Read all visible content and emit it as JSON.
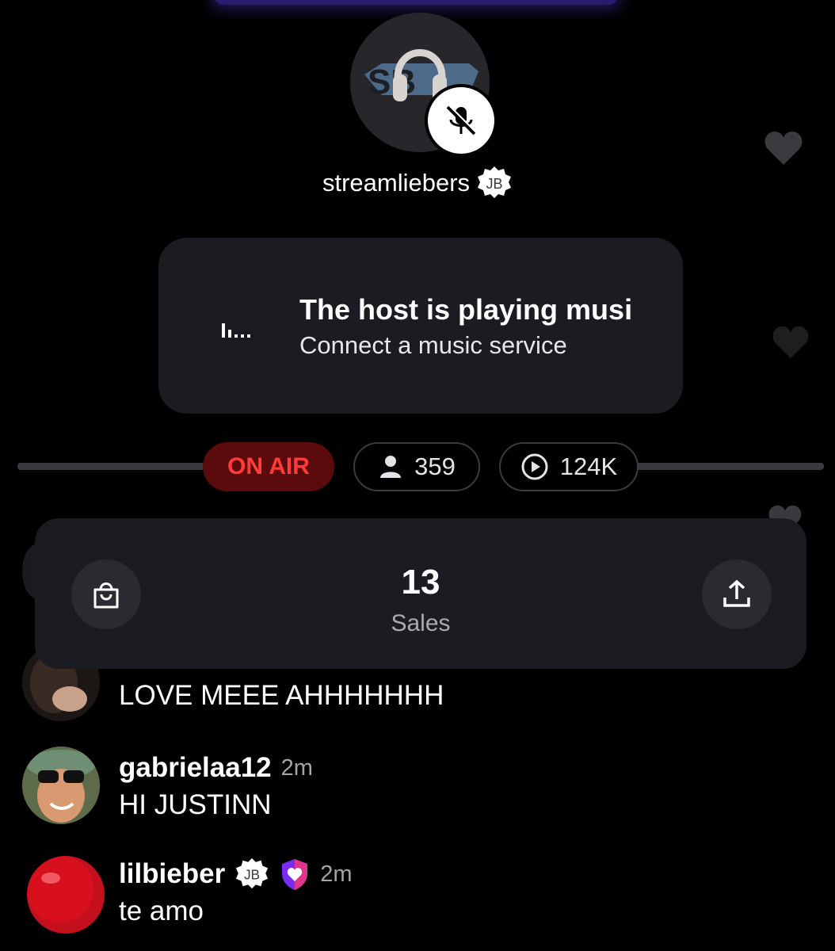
{
  "host": {
    "username": "streamliebers",
    "badge_text": "JB"
  },
  "music_card": {
    "title": "The host is playing musi",
    "subtitle": "Connect a music service",
    "icon": "audio-bars-icon"
  },
  "stats": {
    "status": "ON AIR",
    "viewers": "359",
    "plays": "124K",
    "status_color": "#ff3b3b"
  },
  "sales": {
    "value": "13",
    "label": "Sales"
  },
  "comments": [
    {
      "username": "",
      "time": "",
      "text": "LOVE MEEE AHHHHHHH"
    },
    {
      "username": "gabrielaa12",
      "time": "2m",
      "text": "HI JUSTINN"
    },
    {
      "username": "lilbieber",
      "badge_text": "JB",
      "time": "2m",
      "text": "te amo"
    }
  ],
  "colors": {
    "background": "#000000",
    "card": "#1b1c22",
    "accent_purple": "#6b2bd6"
  }
}
